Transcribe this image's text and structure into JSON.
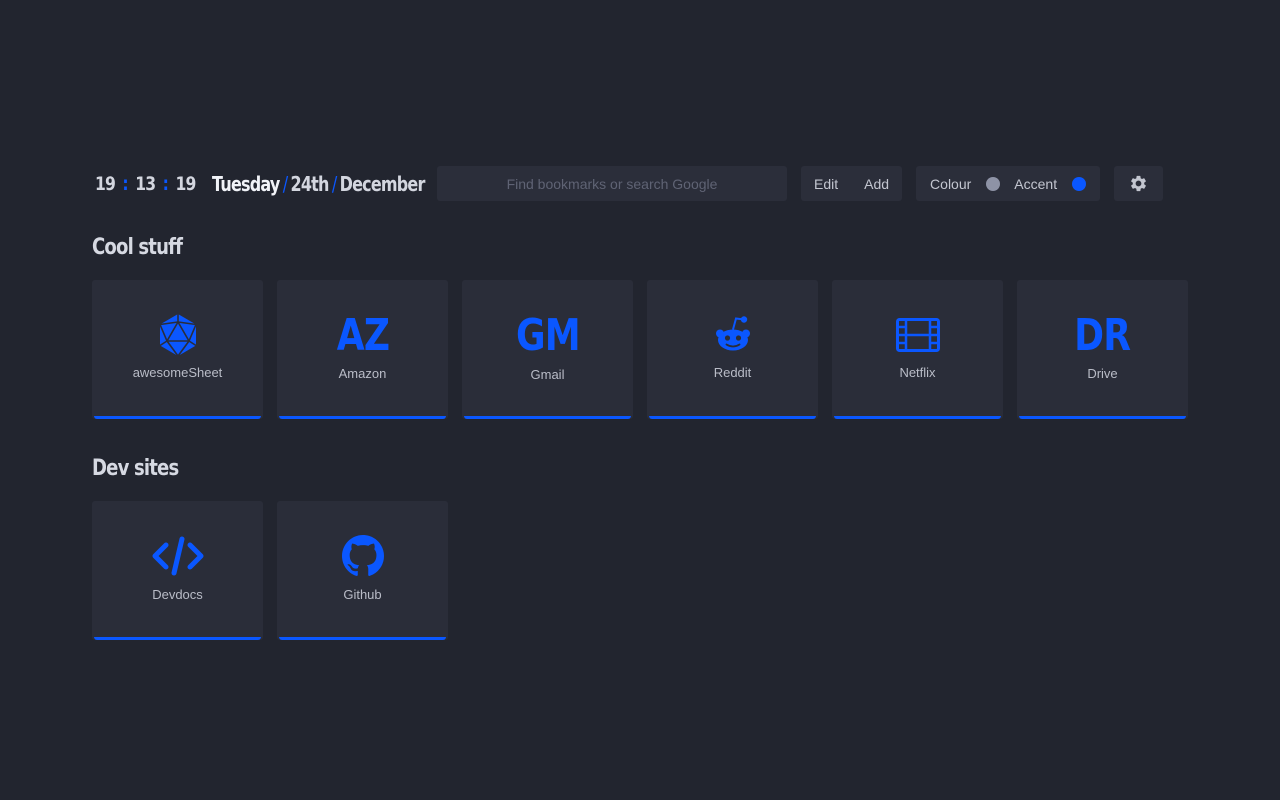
{
  "clock": {
    "hours": "19",
    "minutes": "13",
    "seconds": "19",
    "separator": ":"
  },
  "date": {
    "weekday": "Tuesday",
    "day": "24th",
    "month": "December",
    "separator": "/"
  },
  "search": {
    "placeholder": "Find bookmarks or search Google",
    "value": ""
  },
  "actions": {
    "edit_label": "Edit",
    "add_label": "Add"
  },
  "theme": {
    "colour_label": "Colour",
    "accent_label": "Accent",
    "colour_dot": "#8e93a6",
    "accent_dot": "#0a57ff"
  },
  "settings": {
    "icon": "gear-icon"
  },
  "accent_color": "#0a57ff",
  "sections": [
    {
      "title": "Cool stuff",
      "bookmarks": [
        {
          "label": "awesomeSheet",
          "icon": "d20-icon"
        },
        {
          "label": "Amazon",
          "abbr": "AZ"
        },
        {
          "label": "Gmail",
          "abbr": "GM"
        },
        {
          "label": "Reddit",
          "icon": "reddit-icon"
        },
        {
          "label": "Netflix",
          "icon": "film-icon"
        },
        {
          "label": "Drive",
          "abbr": "DR"
        }
      ]
    },
    {
      "title": "Dev sites",
      "bookmarks": [
        {
          "label": "Devdocs",
          "icon": "code-icon"
        },
        {
          "label": "Github",
          "icon": "github-icon"
        }
      ]
    }
  ]
}
